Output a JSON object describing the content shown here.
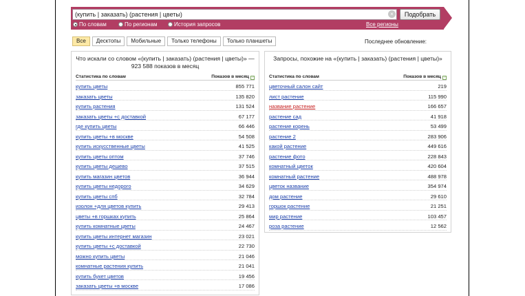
{
  "search": {
    "query": "(купить | заказать) (растения | цветы)",
    "clear_glyph": "×",
    "submit_label": "Подобрать",
    "modes": [
      {
        "label": "По словам",
        "selected": true
      },
      {
        "label": "По регионам",
        "selected": false
      },
      {
        "label": "История запросов",
        "selected": false
      }
    ],
    "all_regions": "Все регионы"
  },
  "tabs": [
    {
      "label": "Все",
      "active": true
    },
    {
      "label": "Десктопы",
      "active": false
    },
    {
      "label": "Мобильные",
      "active": false
    },
    {
      "label": "Только телефоны",
      "active": false
    },
    {
      "label": "Только планшеты",
      "active": false
    }
  ],
  "last_update": "Последнее обновление:",
  "left_panel": {
    "title": "Что искали со словом «(купить | заказать) (растения | цветы)» — 923 588 показов в месяц",
    "col_keyword": "Статистика по словам",
    "col_count": "Показов в месяц",
    "rows": [
      {
        "keyword": "купить цветы",
        "count": "855 771"
      },
      {
        "keyword": "заказать цветы",
        "count": "135 820"
      },
      {
        "keyword": "купить растения",
        "count": "131 524"
      },
      {
        "keyword": "заказать цветы +с доставкой",
        "count": "67 177"
      },
      {
        "keyword": "где купить цветы",
        "count": "66 446"
      },
      {
        "keyword": "купить цветы +в москве",
        "count": "54 508"
      },
      {
        "keyword": "купить искусственные цветы",
        "count": "41 525"
      },
      {
        "keyword": "купить цветы оптом",
        "count": "37 746"
      },
      {
        "keyword": "купить цветы дешево",
        "count": "37 515"
      },
      {
        "keyword": "купить магазин цветов",
        "count": "36 944"
      },
      {
        "keyword": "купить цветы недорого",
        "count": "34 629"
      },
      {
        "keyword": "купить цветы спб",
        "count": "32 784"
      },
      {
        "keyword": "изолон +для цветов купить",
        "count": "29 413"
      },
      {
        "keyword": "цветы +в горшках купить",
        "count": "25 864"
      },
      {
        "keyword": "купить комнатные цветы",
        "count": "24 467"
      },
      {
        "keyword": "купить цветы интернет магазин",
        "count": "23 021"
      },
      {
        "keyword": "купить цветы +с доставкой",
        "count": "22 730"
      },
      {
        "keyword": "можно купить цветы",
        "count": "21 046"
      },
      {
        "keyword": "комнатные растения купить",
        "count": "21 041"
      },
      {
        "keyword": "купить букет цветов",
        "count": "19 456"
      },
      {
        "keyword": "заказать цветы +в москве",
        "count": "17 086"
      }
    ]
  },
  "right_panel": {
    "title": "Запросы, похожие на «(купить | заказать) (растения | цветы)»",
    "col_keyword": "Статистика по словам",
    "col_count": "Показов в месяц",
    "rows": [
      {
        "keyword": "цветочный салон сайт",
        "count": "219",
        "red": false
      },
      {
        "keyword": "лист растение",
        "count": "115 990",
        "red": false
      },
      {
        "keyword": "название растение",
        "count": "166 657",
        "red": true
      },
      {
        "keyword": "растение сад",
        "count": "41 918",
        "red": false
      },
      {
        "keyword": "растение корень",
        "count": "53 499",
        "red": false
      },
      {
        "keyword": "растение 2",
        "count": "283 906",
        "red": false
      },
      {
        "keyword": "какой растение",
        "count": "449 616",
        "red": false
      },
      {
        "keyword": "растение фото",
        "count": "228 843",
        "red": false
      },
      {
        "keyword": "комнатный цветок",
        "count": "420 604",
        "red": false
      },
      {
        "keyword": "комнатный растение",
        "count": "488 978",
        "red": false
      },
      {
        "keyword": "цветок название",
        "count": "354 974",
        "red": false
      },
      {
        "keyword": "дом растение",
        "count": "29 610",
        "red": false
      },
      {
        "keyword": "горшок растение",
        "count": "21 251",
        "red": false
      },
      {
        "keyword": "мир растение",
        "count": "103 457",
        "red": false
      },
      {
        "keyword": "роза растение",
        "count": "12 562",
        "red": false
      }
    ]
  },
  "colors": {
    "band": "#b23d63",
    "active_tab": "#fde9a6",
    "link": "#1a3faa",
    "link_red": "#c62020"
  }
}
